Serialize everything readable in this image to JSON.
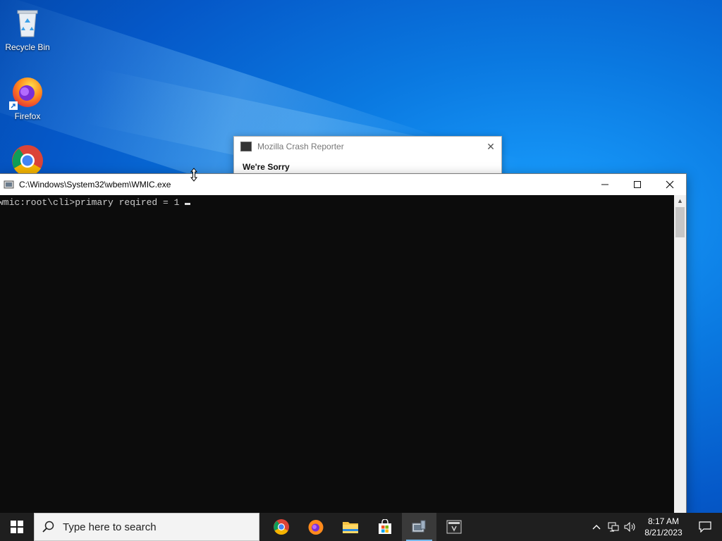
{
  "desktop": {
    "icons": [
      {
        "label": "Recycle Bin",
        "icon": "recycle-bin-icon"
      },
      {
        "label": "Firefox",
        "icon": "firefox-icon"
      },
      {
        "label": "",
        "icon": "chrome-icon"
      }
    ]
  },
  "crash_reporter": {
    "title": "Mozilla Crash Reporter",
    "heading": "We're Sorry"
  },
  "console": {
    "title": "C:\\Windows\\System32\\wbem\\WMIC.exe",
    "line": "wmic:root\\cli>primary reqired = 1"
  },
  "taskbar": {
    "search_placeholder": "Type here to search",
    "apps": [
      "chrome-icon",
      "firefox-icon",
      "file-explorer-icon",
      "microsoft-store-icon",
      "wmic-icon",
      "crash-reporter-icon"
    ],
    "active_app": "wmic-icon",
    "clock_time": "8:17 AM",
    "clock_date": "8/21/2023"
  },
  "colors": {
    "console_bg": "#0c0c0c",
    "taskbar_bg": "#1f1f1f",
    "accent": "#76b9ed"
  }
}
